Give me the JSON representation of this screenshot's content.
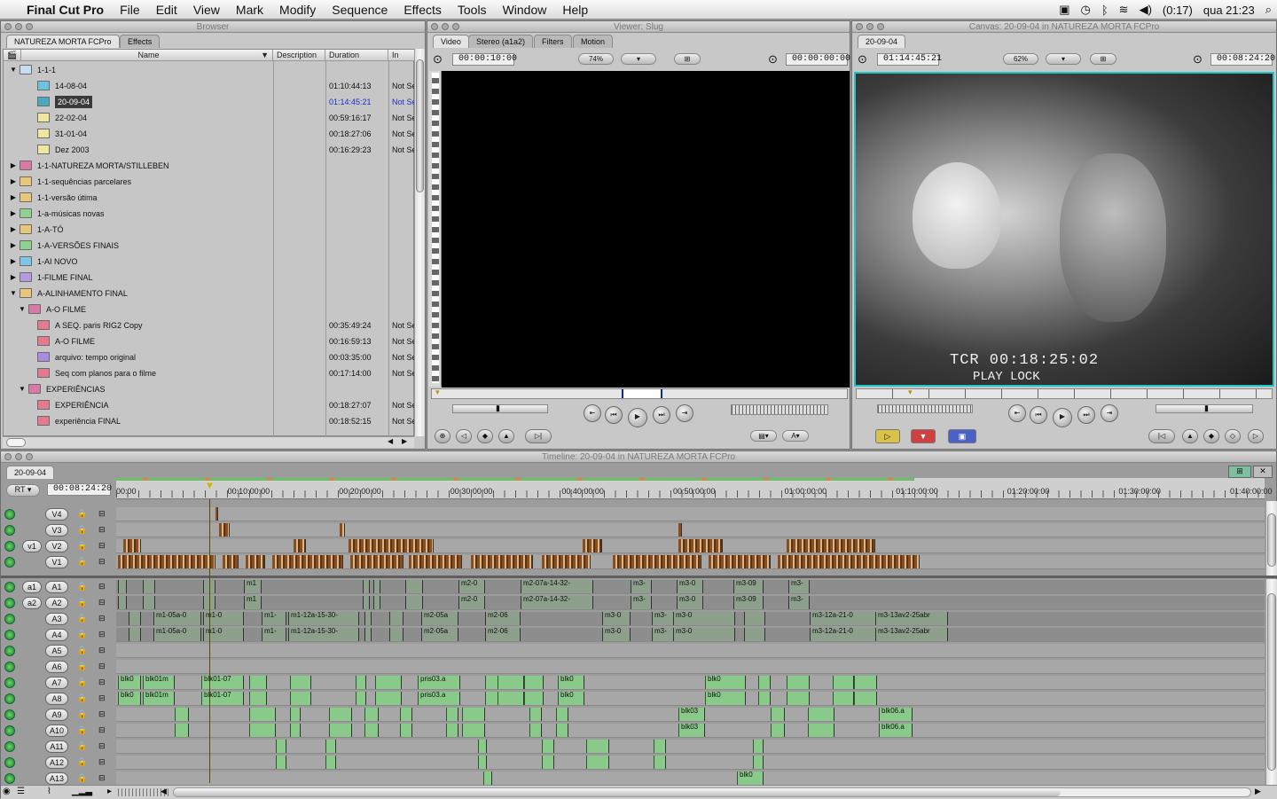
{
  "menubar": {
    "app": "Final Cut Pro",
    "items": [
      "File",
      "Edit",
      "View",
      "Mark",
      "Modify",
      "Sequence",
      "Effects",
      "Tools",
      "Window",
      "Help"
    ],
    "battery": "(0:17)",
    "clock": "qua 21:23"
  },
  "browser": {
    "title": "Browser",
    "tabs": [
      "NATUREZA MORTA FCPro",
      "Effects"
    ],
    "columns": [
      "Name",
      "Description",
      "Duration",
      "In"
    ],
    "rows": [
      {
        "name": "1-1-1",
        "dur": "",
        "in": "",
        "indent": 0,
        "tri": "▼",
        "icon": "bin",
        "color": "#c9dcf5"
      },
      {
        "name": "14-08-04",
        "dur": "01:10:44:13",
        "in": "Not Se",
        "indent": 2,
        "tri": "",
        "icon": "seq",
        "color": "#6cc4dc"
      },
      {
        "name": "20-09-04",
        "dur": "01:14:45:21",
        "in": "Not Se",
        "indent": 2,
        "tri": "",
        "icon": "seq",
        "color": "#4aa8c0",
        "sel": true
      },
      {
        "name": "22-02-04",
        "dur": "00:59:16:17",
        "in": "Not Se",
        "indent": 2,
        "tri": "",
        "icon": "seq",
        "color": "#f1e6a0"
      },
      {
        "name": "31-01-04",
        "dur": "00:18:27:06",
        "in": "Not Se",
        "indent": 2,
        "tri": "",
        "icon": "seq",
        "color": "#f1e6a0"
      },
      {
        "name": "Dez 2003",
        "dur": "00:16:29:23",
        "in": "Not Se",
        "indent": 2,
        "tri": "",
        "icon": "seq",
        "color": "#f1e6a0"
      },
      {
        "name": "1-1-NATUREZA MORTA/STILLEBEN",
        "dur": "",
        "in": "",
        "indent": 0,
        "tri": "▶",
        "icon": "bin",
        "color": "#d97aa6"
      },
      {
        "name": "1-1-sequências parcelares",
        "dur": "",
        "in": "",
        "indent": 0,
        "tri": "▶",
        "icon": "bin",
        "color": "#e9c67a"
      },
      {
        "name": "1-1-versão útima",
        "dur": "",
        "in": "",
        "indent": 0,
        "tri": "▶",
        "icon": "bin",
        "color": "#e9c67a"
      },
      {
        "name": "1-a-músicas novas",
        "dur": "",
        "in": "",
        "indent": 0,
        "tri": "▶",
        "icon": "bin",
        "color": "#8fd18f"
      },
      {
        "name": "1-A-TÓ",
        "dur": "",
        "in": "",
        "indent": 0,
        "tri": "▶",
        "icon": "bin",
        "color": "#e9c67a"
      },
      {
        "name": "1-A-VERSÕES FINAIS",
        "dur": "",
        "in": "",
        "indent": 0,
        "tri": "▶",
        "icon": "bin",
        "color": "#8fd18f"
      },
      {
        "name": "1-AI NOVO",
        "dur": "",
        "in": "",
        "indent": 0,
        "tri": "▶",
        "icon": "bin",
        "color": "#7cc7e6"
      },
      {
        "name": "1-FILME FINAL",
        "dur": "",
        "in": "",
        "indent": 0,
        "tri": "▶",
        "icon": "bin",
        "color": "#b59ae0"
      },
      {
        "name": "A-ALINHAMENTO FINAL",
        "dur": "",
        "in": "",
        "indent": 0,
        "tri": "▼",
        "icon": "bin",
        "color": "#e9c67a"
      },
      {
        "name": "A-O FILME",
        "dur": "",
        "in": "",
        "indent": 1,
        "tri": "▼",
        "icon": "bin",
        "color": "#d97aa6"
      },
      {
        "name": "A SEQ. paris RIG2 Copy",
        "dur": "00:35:49:24",
        "in": "Not Se",
        "indent": 2,
        "tri": "",
        "icon": "seq",
        "color": "#e57a8e"
      },
      {
        "name": "A-O FILME",
        "dur": "00:16:59:13",
        "in": "Not Se",
        "indent": 2,
        "tri": "",
        "icon": "seq",
        "color": "#e57a8e"
      },
      {
        "name": "arquivo: tempo original",
        "dur": "00:03:35:00",
        "in": "Not Se",
        "indent": 2,
        "tri": "",
        "icon": "seq",
        "color": "#a98be0"
      },
      {
        "name": "Seq com planos para o filme",
        "dur": "00:17:14:00",
        "in": "Not Se",
        "indent": 2,
        "tri": "",
        "icon": "seq",
        "color": "#e57a8e"
      },
      {
        "name": "EXPERIÊNCIAS",
        "dur": "",
        "in": "",
        "indent": 1,
        "tri": "▼",
        "icon": "bin",
        "color": "#d97aa6"
      },
      {
        "name": "EXPERIÊNCIA",
        "dur": "00:18:27:07",
        "in": "Not Se",
        "indent": 2,
        "tri": "",
        "icon": "seq",
        "color": "#e57a8e"
      },
      {
        "name": "experiência FINAL",
        "dur": "00:18:52:15",
        "in": "Not Se",
        "indent": 2,
        "tri": "",
        "icon": "seq",
        "color": "#e57a8e"
      }
    ]
  },
  "viewer": {
    "title": "Viewer: Slug",
    "tabs": [
      "Video",
      "Stereo (a1a2)",
      "Filters",
      "Motion"
    ],
    "tc_left": "00:00:10:00",
    "zoom": "74%",
    "tc_right": "00:00:00:00"
  },
  "canvas": {
    "title": "Canvas: 20-09-04 in NATUREZA MORTA FCPro",
    "tab": "20-09-04",
    "tc_left": "01:14:45:21",
    "zoom": "62%",
    "tc_right": "00:08:24:20",
    "overlay1": "TCR  00:18:25:02",
    "overlay2": "PLAY     LOCK"
  },
  "timeline": {
    "title": "Timeline: 20-09-04 in NATUREZA MORTA FCPro",
    "tab": "20-09-04",
    "rt": "RT",
    "tc": "00:08:24:20",
    "ruler": [
      "00:00",
      "00:10:00:00",
      "00:20:00:00",
      "00:30:00:00",
      "00:40:00:00",
      "00:50:00:00",
      "01:00:00:00",
      "01:10:00:00",
      "01:20:00:00",
      "01:30:00:00",
      "01:40:00:00"
    ],
    "video_tracks": [
      {
        "label": "V4",
        "src": ""
      },
      {
        "label": "V3",
        "src": ""
      },
      {
        "label": "V2",
        "src": "v1"
      },
      {
        "label": "V1",
        "src": ""
      }
    ],
    "audio_tracks": [
      {
        "label": "A1",
        "src": "a1"
      },
      {
        "label": "A2",
        "src": "a2"
      },
      {
        "label": "A3",
        "src": ""
      },
      {
        "label": "A4",
        "src": ""
      },
      {
        "label": "A5",
        "src": ""
      },
      {
        "label": "A6",
        "src": ""
      },
      {
        "label": "A7",
        "src": ""
      },
      {
        "label": "A8",
        "src": ""
      },
      {
        "label": "A9",
        "src": ""
      },
      {
        "label": "A10",
        "src": ""
      },
      {
        "label": "A11",
        "src": ""
      },
      {
        "label": "A12",
        "src": ""
      },
      {
        "label": "A13",
        "src": ""
      }
    ],
    "clip_names": {
      "a1": [
        "m1",
        "m2-0",
        "m2-07a-14-32-",
        "m3-",
        "m3-0",
        "m3-09",
        "m3-"
      ],
      "a3": [
        "m1-05a-0",
        "m1-0",
        "m1-",
        "m1-12a-15-30-",
        "m2-05a",
        "m2-06",
        "m3-0",
        "m3-",
        "m3-0",
        "m3-12a-21-0",
        "m3-13av2-25abr"
      ],
      "a7": [
        "blk0",
        "blk01m",
        "blk01-07",
        "pris03.a",
        "blk0",
        "blk0"
      ],
      "a9": [
        "blk03",
        "blk06.a"
      ],
      "a13": [
        "blk0"
      ]
    }
  }
}
